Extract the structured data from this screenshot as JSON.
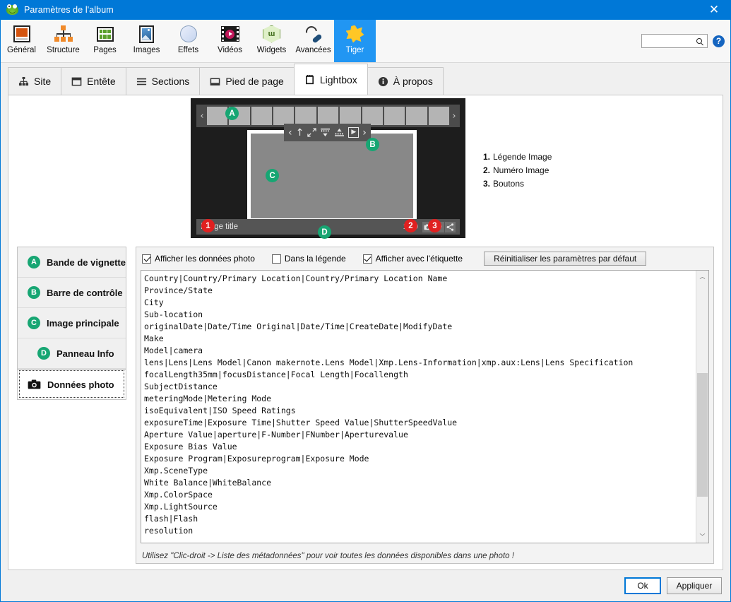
{
  "window": {
    "title": "Paramètres de l'album",
    "app_icon": "frog-icon",
    "close_label": "✕",
    "accent": "#0078d7"
  },
  "ribbon": {
    "items": [
      {
        "label": "Général",
        "icon": "general-icon",
        "active": false
      },
      {
        "label": "Structure",
        "icon": "structure-icon",
        "active": false
      },
      {
        "label": "Pages",
        "icon": "pages-icon",
        "active": false
      },
      {
        "label": "Images",
        "icon": "images-icon",
        "active": false
      },
      {
        "label": "Effets",
        "icon": "effects-icon",
        "active": false
      },
      {
        "label": "Vidéos",
        "icon": "videos-icon",
        "active": false
      },
      {
        "label": "Widgets",
        "icon": "widgets-icon",
        "active": false
      },
      {
        "label": "Avancées",
        "icon": "advanced-icon",
        "active": false
      },
      {
        "label": "Tiger",
        "icon": "tiger-star-icon",
        "active": true
      }
    ],
    "widgets_glyph": "ɯ",
    "search": {
      "value": "",
      "placeholder": "",
      "icon": "search-icon"
    },
    "help": {
      "label": "?",
      "icon": "help-icon"
    },
    "active_color": "#2196f3"
  },
  "subtabs": [
    {
      "label": "Site",
      "icon": "sitemap-icon",
      "active": false
    },
    {
      "label": "Entête",
      "icon": "header-icon",
      "active": false
    },
    {
      "label": "Sections",
      "icon": "list-icon",
      "active": false
    },
    {
      "label": "Pied de page",
      "icon": "footer-icon",
      "active": false
    },
    {
      "label": "Lightbox",
      "icon": "lightbox-icon",
      "active": true
    },
    {
      "label": "À propos",
      "icon": "info-icon",
      "active": false
    }
  ],
  "preview": {
    "strip_prev": "‹",
    "strip_next": "›",
    "thumbnail_count": 11,
    "controls": [
      "‹",
      "↑",
      "⤢",
      "caption-top-icon",
      "caption-bottom-icon",
      "▶",
      "›"
    ],
    "play_glyph": "▶",
    "image_title": "Image title",
    "counter": "1/10",
    "info_buttons": [
      "camera-icon",
      "map-pin-icon",
      "share-icon"
    ],
    "markers": {
      "A": "A",
      "B": "B",
      "C": "C",
      "D": "D",
      "one": "1",
      "two": "2",
      "three": "3"
    },
    "legend": [
      {
        "num": "1.",
        "text": "Légende Image"
      },
      {
        "num": "2.",
        "text": "Numéro Image"
      },
      {
        "num": "3.",
        "text": "Boutons"
      }
    ]
  },
  "sidebar": {
    "items": [
      {
        "badge": "A",
        "label": "Bande de vignette",
        "selected": false,
        "indent": false
      },
      {
        "badge": "B",
        "label": "Barre de contrôle",
        "selected": false,
        "indent": false
      },
      {
        "badge": "C",
        "label": "Image principale",
        "selected": false,
        "indent": false
      },
      {
        "badge": "D",
        "label": "Panneau Info",
        "selected": false,
        "indent": true
      },
      {
        "badge": "camera-icon",
        "label": "Données photo",
        "selected": true,
        "indent": false
      }
    ]
  },
  "options": {
    "checkboxes": [
      {
        "label": "Afficher les données photo",
        "checked": true
      },
      {
        "label": "Dans la légende",
        "checked": false
      },
      {
        "label": "Afficher avec l'étiquette",
        "checked": true
      }
    ],
    "reset_button": "Réinitialiser les paramètres par défaut"
  },
  "editor": {
    "lines": [
      "Country|Country/Primary Location|Country/Primary Location Name",
      "Province/State",
      "City",
      "Sub-location",
      "originalDate|Date/Time Original|Date/Time|CreateDate|ModifyDate",
      "Make",
      "Model|camera",
      "lens|Lens|Lens Model|Canon makernote.Lens Model|Xmp.Lens-Information|xmp.aux:Lens|Lens Specification",
      "focalLength35mm|focusDistance|Focal Length|Focallength",
      "SubjectDistance",
      "meteringMode|Metering Mode",
      "isoEquivalent|ISO Speed Ratings",
      "exposureTime|Exposure Time|Shutter Speed Value|ShutterSpeedValue",
      "Aperture Value|aperture|F-Number|FNumber|Aperturevalue",
      "Exposure Bias Value",
      "Exposure Program|Exposureprogram|Exposure Mode",
      "Xmp.SceneType",
      "White Balance|WhiteBalance",
      "Xmp.ColorSpace",
      "Xmp.LightSource",
      "flash|Flash",
      "resolution"
    ],
    "scroll_up": "︿",
    "scroll_down": "﹀"
  },
  "hint": "Utilisez \"Clic-droit -> Liste des métadonnées\" pour voir toutes les données disponibles dans une photo !",
  "footer": {
    "ok": "Ok",
    "apply": "Appliquer"
  }
}
